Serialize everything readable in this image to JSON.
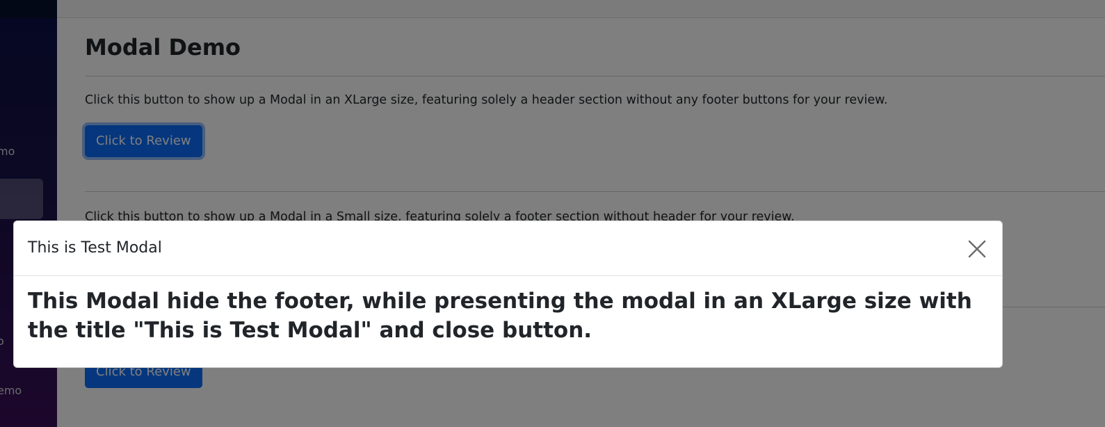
{
  "sidebar": {
    "items": [
      {
        "label": "mo"
      },
      {
        "label": "o"
      },
      {
        "label": "emo"
      }
    ]
  },
  "main": {
    "title": "Modal Demo",
    "sections": [
      {
        "description": "Click this button to show up a Modal in an XLarge size, featuring solely a header section without any footer buttons for your review.",
        "button_label": "Click to Review"
      },
      {
        "description": "Click this button to show up a Modal in a Small size, featuring solely a footer section without header for your review.",
        "button_label": ""
      },
      {
        "description": "",
        "button_label": "Click to Review"
      }
    ]
  },
  "modal": {
    "title": "This is Test Modal",
    "body": "This Modal hide the footer, while presenting the modal in an XLarge size with the title \"This is Test Modal\" and close button.",
    "close_icon": "close-icon"
  },
  "colors": {
    "primary": "#0d6efd",
    "backdrop": "rgba(0,0,0,0.5)",
    "sidebar_top": "#06112e"
  }
}
